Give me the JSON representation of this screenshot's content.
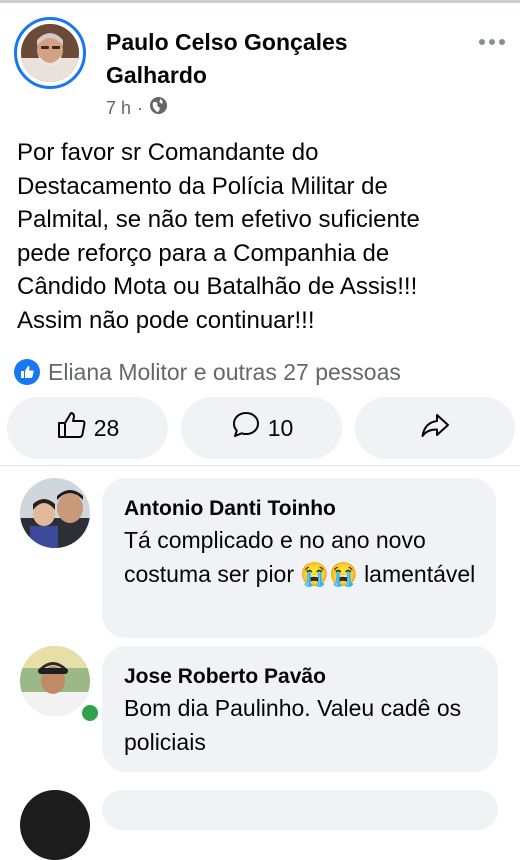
{
  "post": {
    "author": "Paulo Celso Gonçales Galhardo",
    "time": "7 h",
    "separator": "·",
    "privacy_icon": "globe-icon",
    "text": "Por favor sr Comandante do\nDestacamento da Polícia Militar de\nPalmital, se não tem efetivo suficiente\npede reforço para a Companhia de\nCândido Mota ou Batalhão de Assis!!!\nAssim não pode continuar!!!",
    "reactions": "Eliana Molitor e outras 27 pessoas",
    "like_count": "28",
    "comment_count": "10"
  },
  "comments": [
    {
      "name": "Antonio Danti Toinho",
      "text": "Tá complicado e no ano novo costuma ser pior 😭😭 lamentável"
    },
    {
      "name": "Jose Roberto Pavão",
      "text": "Bom dia Paulinho. Valeu cadê os policiais"
    }
  ],
  "colors": {
    "accent": "#1877f2",
    "secondary_text": "#65676b",
    "surface": "#f0f2f5",
    "online": "#31a24c"
  }
}
